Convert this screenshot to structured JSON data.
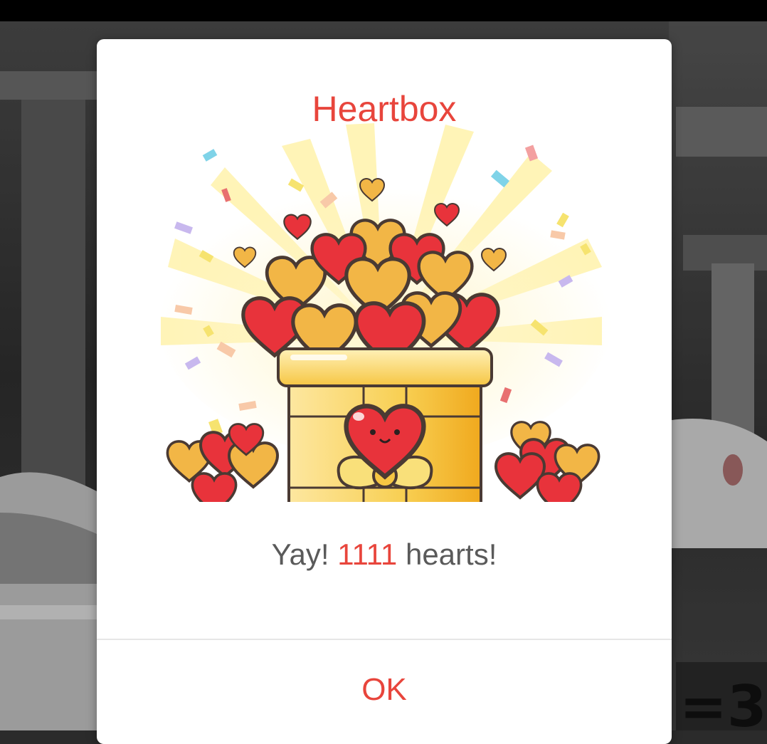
{
  "dialog": {
    "title": "Heartbox",
    "message_prefix": "Yay! ",
    "heart_count": "1111",
    "message_suffix": " hearts!",
    "ok_label": "OK"
  },
  "illustration": {
    "icon": "heart-gift-box-icon"
  },
  "colors": {
    "accent": "#e8453c",
    "message_text": "#5a5a5a",
    "dialog_background": "#ffffff"
  }
}
